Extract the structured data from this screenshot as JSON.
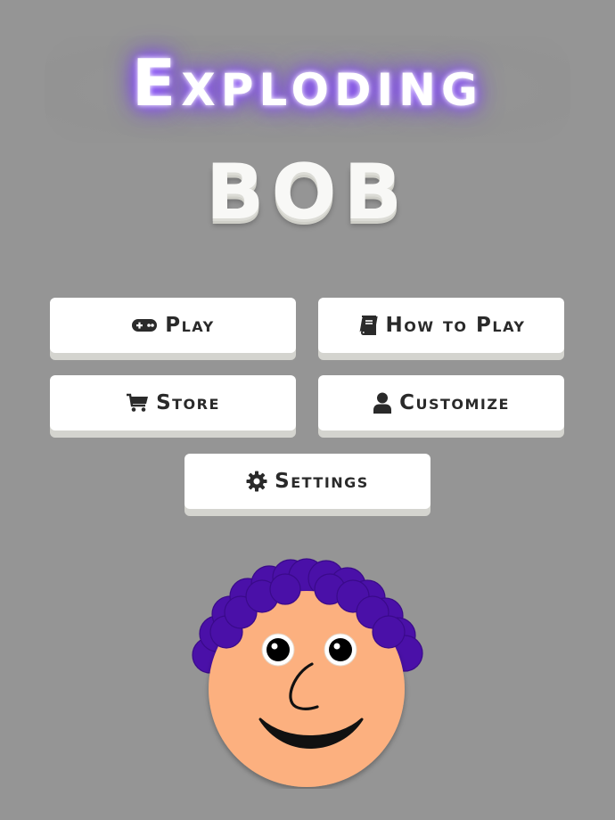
{
  "title": {
    "line1": "Exploding",
    "line2": "BOB"
  },
  "menu": {
    "play": {
      "label": "Play",
      "icon": "gamepad-icon"
    },
    "how_to_play": {
      "label": "How to Play",
      "icon": "book-icon"
    },
    "store": {
      "label": "Store",
      "icon": "cart-icon"
    },
    "customize": {
      "label": "Customize",
      "icon": "user-icon"
    },
    "settings": {
      "label": "Settings",
      "icon": "gear-icon"
    }
  },
  "colors": {
    "background": "#959595",
    "glow": "#7b3cff",
    "hair": "#4a10a8",
    "skin": "#fcb07f"
  }
}
